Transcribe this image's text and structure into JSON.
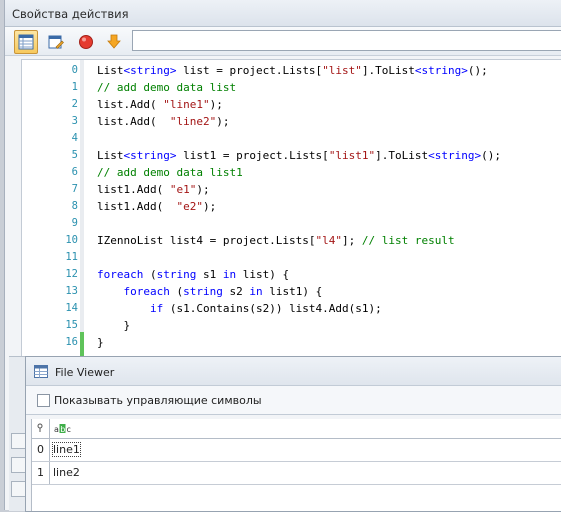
{
  "window": {
    "title": "Свойства действия"
  },
  "toolbar": {
    "icons": [
      "table-view-icon",
      "edit-view-icon",
      "stop-icon",
      "download-arrow-icon"
    ],
    "input_value": ""
  },
  "code": {
    "line_numbers": [
      "0",
      "1",
      "2",
      "3",
      "4",
      "5",
      "6",
      "7",
      "8",
      "9",
      "10",
      "11",
      "12",
      "13",
      "14",
      "15",
      "16"
    ]
  },
  "file_viewer": {
    "title": "File Viewer",
    "checkbox_label": "Показывать управляющие символы",
    "col_icon": "abc-icon",
    "rows": [
      {
        "index": "0",
        "value": "line1"
      },
      {
        "index": "1",
        "value": "line2"
      }
    ]
  },
  "colors": {
    "keyword": "#0000ff",
    "string": "#a31515",
    "comment": "#008000",
    "line_number": "#2b91af",
    "changed_marker": "#5fc35a"
  }
}
